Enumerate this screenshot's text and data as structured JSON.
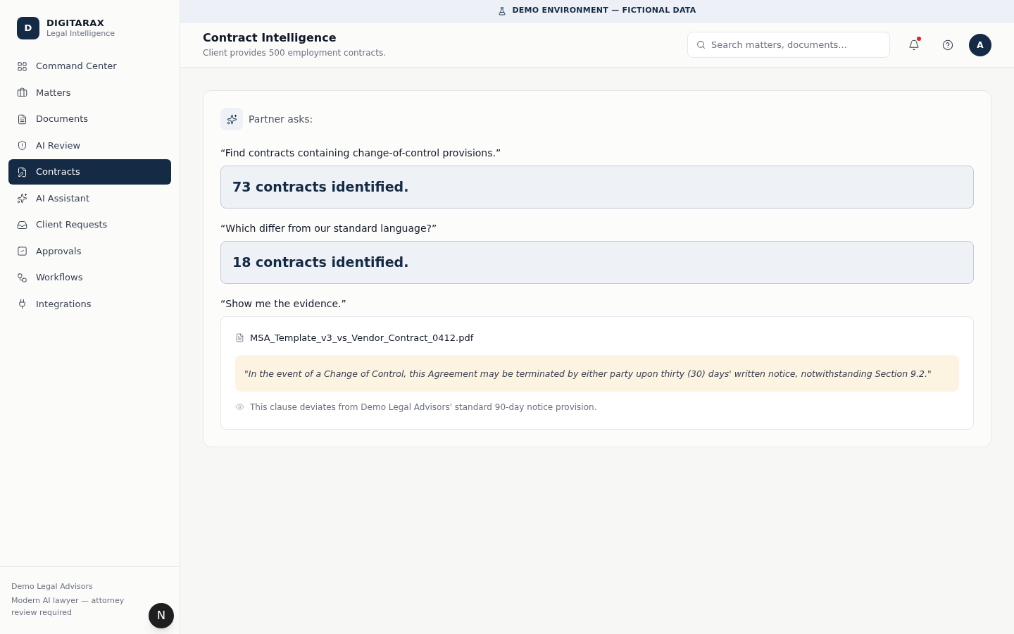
{
  "brand": {
    "logo_letter": "D",
    "name": "DIGITARAX",
    "tagline": "Legal Intelligence"
  },
  "sidebar": {
    "items": [
      {
        "label": "Command Center",
        "selected": false
      },
      {
        "label": "Matters",
        "selected": false
      },
      {
        "label": "Documents",
        "selected": false
      },
      {
        "label": "AI Review",
        "selected": false
      },
      {
        "label": "Contracts",
        "selected": true
      },
      {
        "label": "AI Assistant",
        "selected": false
      },
      {
        "label": "Client Requests",
        "selected": false
      },
      {
        "label": "Approvals",
        "selected": false
      },
      {
        "label": "Workflows",
        "selected": false
      },
      {
        "label": "Integrations",
        "selected": false
      }
    ],
    "footer": {
      "firm": "Demo Legal Advisors",
      "note": "Modern AI lawyer — attorney review required"
    },
    "dev_badge": "N"
  },
  "banner": "DEMO ENVIRONMENT — FICTIONAL DATA",
  "header": {
    "title": "Contract Intelligence",
    "subtitle": "Client provides 500 employment contracts.",
    "search": {
      "placeholder": "Search matters, documents..."
    },
    "notifications_unread": true,
    "avatar": "A"
  },
  "conversation": {
    "intro": "Partner asks:",
    "turns": [
      {
        "kind": "answer",
        "question": "“Find contracts containing change-of-control provisions.”",
        "answer": "73 contracts identified."
      },
      {
        "kind": "answer",
        "question": "“Which differ from our standard language?”",
        "answer": "18 contracts identified."
      },
      {
        "kind": "evidence",
        "question": "“Show me the evidence.”",
        "file": "MSA_Template_v3_vs_Vendor_Contract_0412.pdf",
        "quote": "\"In the event of a Change of Control, this Agreement may be terminated by either party upon thirty (30) days' written notice, notwithstanding Section 9.2.\"",
        "note": "This clause deviates from Demo Legal Advisors' standard 90-day notice provision."
      }
    ]
  }
}
